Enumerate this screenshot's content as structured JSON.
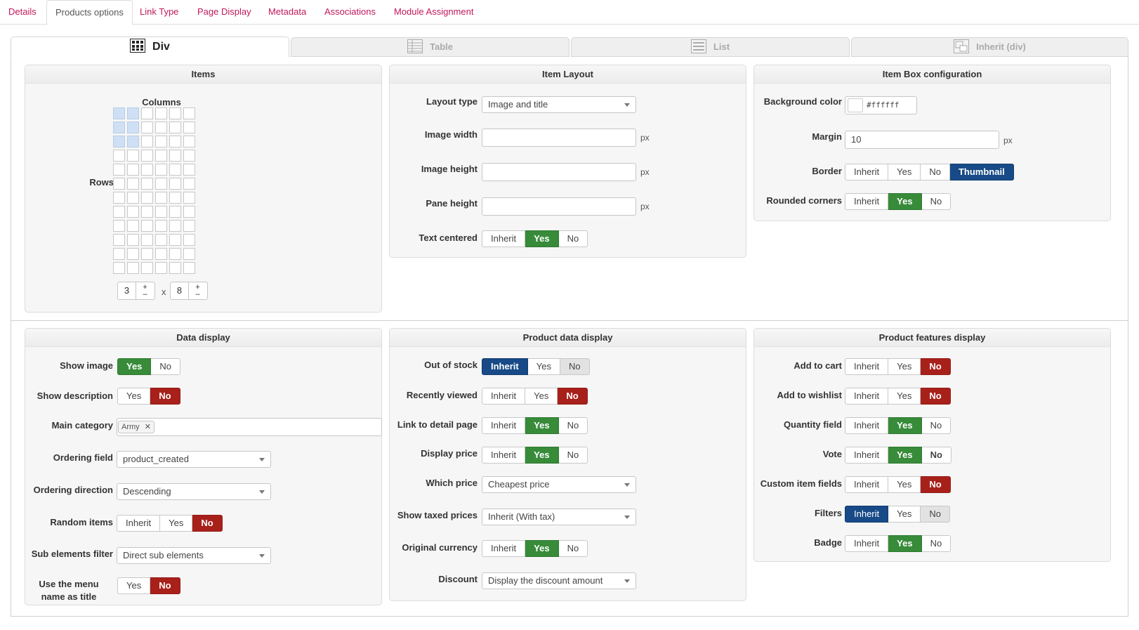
{
  "top_tabs": [
    "Details",
    "Products options",
    "Link Type",
    "Page Display",
    "Metadata",
    "Associations",
    "Module Assignment"
  ],
  "layout_tabs": [
    "Div",
    "Table",
    "List",
    "Inherit (div)"
  ],
  "items_panel": {
    "title": "Items",
    "columns_label": "Columns",
    "rows_label": "Rows",
    "columns_value": "3",
    "times": "x",
    "rows_value": "8",
    "plus": "+",
    "minus": "–"
  },
  "item_layout": {
    "title": "Item Layout",
    "layout_type_label": "Layout type",
    "layout_type_value": "Image and title",
    "image_width_label": "Image width",
    "image_height_label": "Image height",
    "pane_height_label": "Pane height",
    "unit": "px",
    "text_centered_label": "Text centered"
  },
  "item_box": {
    "title": "Item Box configuration",
    "bg_label": "Background color",
    "bg_value": "#ffffff",
    "margin_label": "Margin",
    "margin_value": "10",
    "unit": "px",
    "border_label": "Border",
    "rounded_label": "Rounded corners"
  },
  "data_display": {
    "title": "Data display",
    "show_image_label": "Show image",
    "show_description_label": "Show description",
    "main_category_label": "Main category",
    "main_category_tag": "Army",
    "tag_remove": "✕",
    "ordering_field_label": "Ordering field",
    "ordering_field_value": "product_created",
    "ordering_direction_label": "Ordering direction",
    "ordering_direction_value": "Descending",
    "random_items_label": "Random items",
    "sub_elements_label": "Sub elements filter",
    "sub_elements_value": "Direct sub elements",
    "menu_name_label_1": "Use the menu",
    "menu_name_label_2": "name as title"
  },
  "product_data": {
    "title": "Product data display",
    "out_of_stock_label": "Out of stock",
    "recently_viewed_label": "Recently viewed",
    "link_detail_label": "Link to detail page",
    "display_price_label": "Display price",
    "which_price_label": "Which price",
    "which_price_value": "Cheapest price",
    "taxed_label": "Show taxed prices",
    "taxed_value": "Inherit (With tax)",
    "orig_currency_label": "Original currency",
    "discount_label": "Discount",
    "discount_value": "Display the discount amount"
  },
  "features": {
    "title": "Product features display",
    "add_to_cart_label": "Add to cart",
    "add_to_wishlist_label": "Add to wishlist",
    "quantity_label": "Quantity field",
    "vote_label": "Vote",
    "custom_fields_label": "Custom item fields",
    "filters_label": "Filters",
    "badge_label": "Badge"
  },
  "btn": {
    "inherit": "Inherit",
    "yes": "Yes",
    "no": "No",
    "thumbnail": "Thumbnail"
  },
  "colors": {
    "accent_link": "#c2185b",
    "green": "#378b39",
    "red": "#a8201a",
    "blue": "#174a87",
    "selected_cell": "#cfe0f4"
  },
  "icons": [
    "div-layout-icon",
    "table-layout-icon",
    "list-layout-icon",
    "inherit-layout-icon",
    "caret-down-icon",
    "remove-tag-icon"
  ]
}
